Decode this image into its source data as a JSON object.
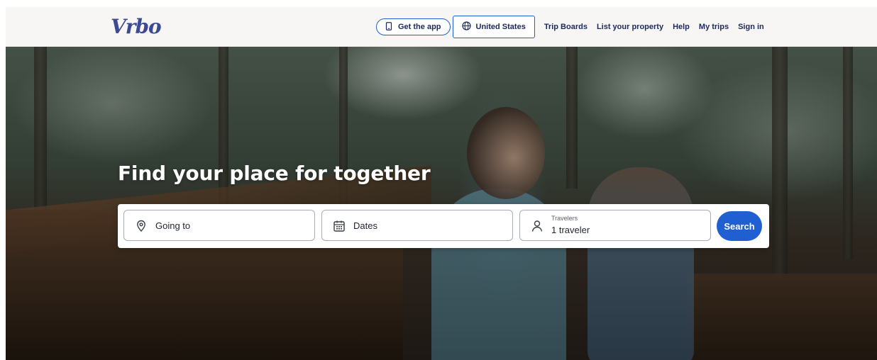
{
  "brand": {
    "logo_text": "Vrbo",
    "logo_color": "#3c4a93"
  },
  "header": {
    "get_app": {
      "label": "Get the app",
      "icon": "phone-icon"
    },
    "country": {
      "label": "United States",
      "icon": "globe-icon"
    },
    "links": [
      {
        "label": "Trip Boards"
      },
      {
        "label": "List your property"
      },
      {
        "label": "Help"
      },
      {
        "label": "My trips"
      },
      {
        "label": "Sign in"
      }
    ]
  },
  "hero": {
    "headline": "Find your place for together"
  },
  "search": {
    "destination": {
      "placeholder": "Going to",
      "icon": "location-pin-icon"
    },
    "dates": {
      "placeholder": "Dates",
      "icon": "calendar-icon"
    },
    "travelers": {
      "label": "Travelers",
      "value": "1 traveler",
      "icon": "person-icon"
    },
    "button_label": "Search"
  },
  "colors": {
    "accent": "#1f5fd1",
    "text_dark": "#1b2a5a",
    "header_bg": "#f7f6f4"
  }
}
